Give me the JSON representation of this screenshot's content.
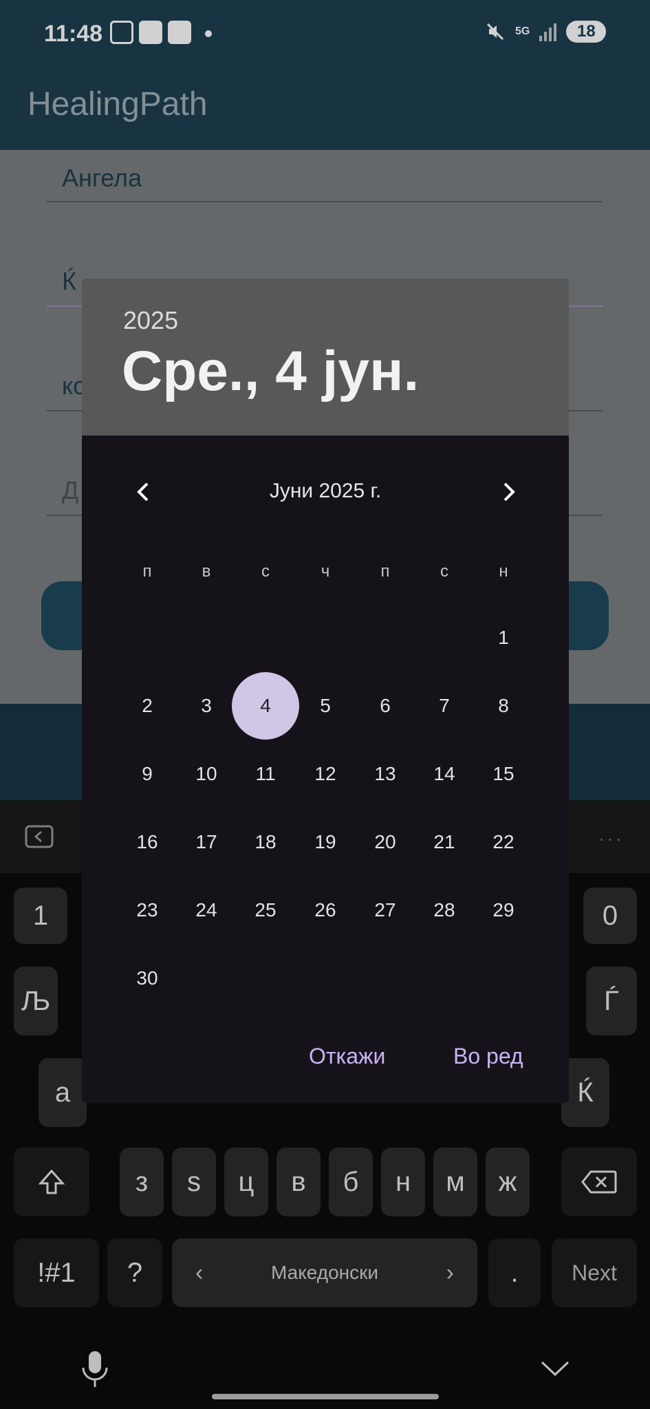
{
  "status_bar": {
    "time": "11:48",
    "network": "5G",
    "battery": "18"
  },
  "app": {
    "title": "HealingPath"
  },
  "form": {
    "name_value": "Ангела",
    "field2_partial": "Ќ",
    "field3_partial": "ко",
    "field4_partial": "Д"
  },
  "dialog": {
    "year": "2025",
    "selected_date": "Сре., 4 јун.",
    "month_label": "Јуни 2025 г.",
    "weekdays": [
      "п",
      "в",
      "с",
      "ч",
      "п",
      "с",
      "н"
    ],
    "days": [
      "1",
      "2",
      "3",
      "4",
      "5",
      "6",
      "7",
      "8",
      "9",
      "10",
      "11",
      "12",
      "13",
      "14",
      "15",
      "16",
      "17",
      "18",
      "19",
      "20",
      "21",
      "22",
      "23",
      "24",
      "25",
      "26",
      "27",
      "28",
      "29",
      "30"
    ],
    "selected_day": "4",
    "cancel_label": "Откажи",
    "ok_label": "Во ред",
    "accent_color": "#c9b4f3"
  },
  "keyboard": {
    "row1_left": "1",
    "row1_right": "0",
    "row2_left": "Љ",
    "row2_right": "Ѓ",
    "row3_left": "а",
    "row3_right": "Ќ",
    "row4": [
      "з",
      "ѕ",
      "ц",
      "в",
      "б",
      "н",
      "м",
      "ж"
    ],
    "symbols_label": "!#1",
    "question_label": "?",
    "language_label": "Македонски",
    "period_label": ".",
    "next_label": "Next"
  }
}
